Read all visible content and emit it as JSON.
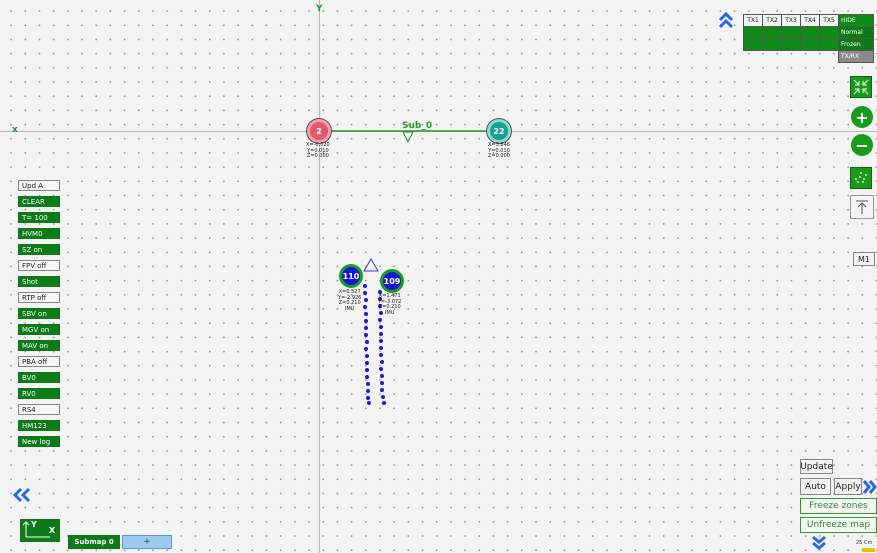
{
  "axes": {
    "x_label": "x",
    "y_label": "Y"
  },
  "tx_table": {
    "headers": [
      "TX1",
      "TX2",
      "TX3",
      "TX4",
      "TX5"
    ],
    "side_labels": [
      "HIDE",
      "Normal",
      "Frozen",
      "TX/RX"
    ]
  },
  "submap_line_label": "Sub_0",
  "nodes": [
    {
      "id": "2",
      "coords": "X=-0.020\nY=0.010\nZ=0.000"
    },
    {
      "id": "22",
      "coords": "X=3.846\nY=0.010\nZ=0.000"
    },
    {
      "id": "110",
      "coords": "X=0.527\nY=-2.926\nZ=0.210\nIMU"
    },
    {
      "id": "109",
      "coords": "X=1.471\nY=-3.072\nZ=0.210\nIMU"
    }
  ],
  "left_buttons": [
    {
      "label": "Upd A",
      "state": "off"
    },
    {
      "label": "CLEAR",
      "state": "on"
    },
    {
      "label": "T= 100",
      "state": "on"
    },
    {
      "label": "HVM0",
      "state": "on"
    },
    {
      "label": "SZ on",
      "state": "on"
    },
    {
      "label": "FPV off",
      "state": "off"
    },
    {
      "label": "Shot",
      "state": "on"
    },
    {
      "label": "RTP off",
      "state": "off"
    },
    {
      "label": "SBV on",
      "state": "on"
    },
    {
      "label": "MGV on",
      "state": "on"
    },
    {
      "label": "MAV on",
      "state": "on"
    },
    {
      "label": "PBA off",
      "state": "off"
    },
    {
      "label": "BV0",
      "state": "on"
    },
    {
      "label": "RV0",
      "state": "on"
    },
    {
      "label": "RS4",
      "state": "off"
    },
    {
      "label": "HM123",
      "state": "on"
    },
    {
      "label": "New log",
      "state": "on"
    }
  ],
  "right_panel": {
    "m1_label": "M1",
    "update_label": "Update",
    "auto_label": "Auto",
    "apply_label": "Apply",
    "freeze_label": "Freeze zones",
    "unfreeze_label": "Unfreeze map",
    "scale_label": "25 Cm"
  },
  "bottom": {
    "submap_label": "Submap 0",
    "add_label": "+",
    "orient_y": "Y",
    "orient_x": "X"
  },
  "icons": {
    "collapse_up": "double-chevron-up-icon",
    "collapse_left": "double-chevron-left-icon",
    "expand_right": "double-chevron-right-icon",
    "expand_down": "double-chevron-down-icon",
    "fit": "shrink-arrows-icon",
    "zoom_in": "plus-icon",
    "zoom_out": "minus-icon",
    "grid": "grid-dots-icon",
    "up": "arrow-up-icon"
  },
  "colors": {
    "accent_green": "#0b7a17",
    "node_blue": "#1515d8",
    "trail_blue": "#1a1ad8"
  }
}
